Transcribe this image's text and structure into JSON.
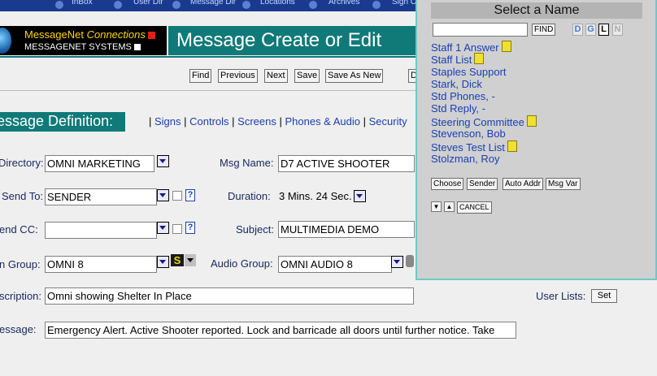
{
  "nav": {
    "items": [
      "InBox",
      "User Dir",
      "Message Dir",
      "Locations",
      "Archives",
      "Sign C"
    ]
  },
  "logo": {
    "line1_a": "MessageNet ",
    "line1_b": "Connections",
    "line2": "MESSAGENET SYSTEMS"
  },
  "page_title": "Message Create or Edit",
  "toolbar": {
    "find": "Find",
    "previous": "Previous",
    "next": "Next",
    "save": "Save",
    "save_as_new": "Save As New",
    "partial": "D"
  },
  "section": {
    "title": "essage Definition:",
    "links": [
      "Signs",
      "Controls",
      "Screens",
      "Phones & Audio",
      "Security"
    ]
  },
  "form": {
    "directory_label": "Directory:",
    "directory_value": "OMNI MARKETING",
    "msg_name_label": "Msg Name:",
    "msg_name_value": "D7 ACTIVE SHOOTER",
    "send_to_label": "Send To:",
    "send_to_value": "SENDER",
    "duration_label": "Duration:",
    "duration_value": "3 Mins. 24 Sec.",
    "send_cc_label": "end CC:",
    "send_cc_value": "",
    "subject_label": "Subject:",
    "subject_value": "MULTIMEDIA DEMO",
    "sign_group_label": "n Group:",
    "sign_group_value": "OMNI 8",
    "sign_icon_label": "S",
    "audio_group_label": "Audio Group:",
    "audio_group_value": "OMNI AUDIO 8",
    "description_label": "scription:",
    "description_value": "Omni showing Shelter In Place",
    "user_lists_label": "User Lists:",
    "set_button": "Set",
    "message_label": "essage:",
    "message_value": "Emergency Alert.  Active Shooter reported.  Lock and barricade all doors until further notice.  Take"
  },
  "popup": {
    "title": "Select a Name",
    "search_value": "",
    "find_button": "FIND",
    "letters": [
      "D",
      "G",
      "L",
      "N"
    ],
    "names": [
      {
        "name": "Staff 1 Answer",
        "book": true
      },
      {
        "name": "Staff List",
        "book": true
      },
      {
        "name": "Staples Support",
        "book": false
      },
      {
        "name": "Stark, Dick",
        "book": false
      },
      {
        "name": "Std Phones, -",
        "book": false
      },
      {
        "name": "Std Reply, -",
        "book": false
      },
      {
        "name": "Steering Committee",
        "book": true
      },
      {
        "name": "Stevenson, Bob",
        "book": false
      },
      {
        "name": "Steves Test List",
        "book": true
      },
      {
        "name": "Stolzman, Roy",
        "book": false
      }
    ],
    "buttons": [
      "Choose",
      "Sender",
      "Auto Addr",
      "Msg Var"
    ],
    "cancel": "CANCEL"
  }
}
